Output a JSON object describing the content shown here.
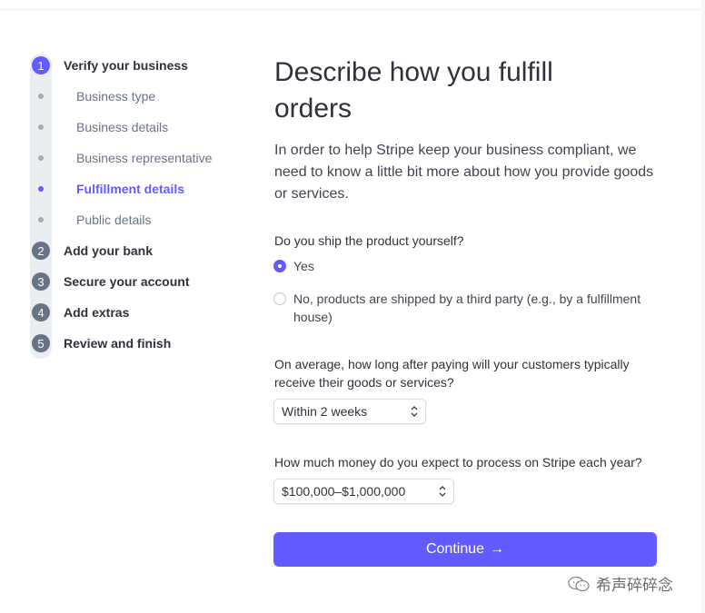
{
  "stepper": {
    "steps": [
      {
        "num": "1",
        "label": "Verify your business"
      },
      {
        "num": "2",
        "label": "Add your bank"
      },
      {
        "num": "3",
        "label": "Secure your account"
      },
      {
        "num": "4",
        "label": "Add extras"
      },
      {
        "num": "5",
        "label": "Review and finish"
      }
    ],
    "substeps": [
      {
        "label": "Business type"
      },
      {
        "label": "Business details"
      },
      {
        "label": "Business representative"
      },
      {
        "label": "Fulfillment details"
      },
      {
        "label": "Public details"
      }
    ],
    "active_step": "1",
    "active_substep": "Fulfillment details"
  },
  "main": {
    "title": "Describe how you fulfill orders",
    "intro": "In order to help Stripe keep your business compliant, we need to know a little bit more about how you provide goods or services.",
    "q1": {
      "label": "Do you ship the product yourself?",
      "options": [
        {
          "label": "Yes",
          "checked": true
        },
        {
          "label": "No, products are shipped by a third party (e.g., by a fulfillment house)",
          "checked": false
        }
      ]
    },
    "q2": {
      "label": "On average, how long after paying will your customers typically receive their goods or services?",
      "value": "Within 2 weeks"
    },
    "q3": {
      "label": "How much money do you expect to process on Stripe each year?",
      "value": "$100,000–$1,000,000"
    },
    "continue_label": "Continue",
    "continue_arrow": "→"
  },
  "watermark": {
    "text": "希声碎碎念"
  },
  "colors": {
    "accent": "#635bff",
    "text": "#30313d",
    "muted": "#687385"
  }
}
